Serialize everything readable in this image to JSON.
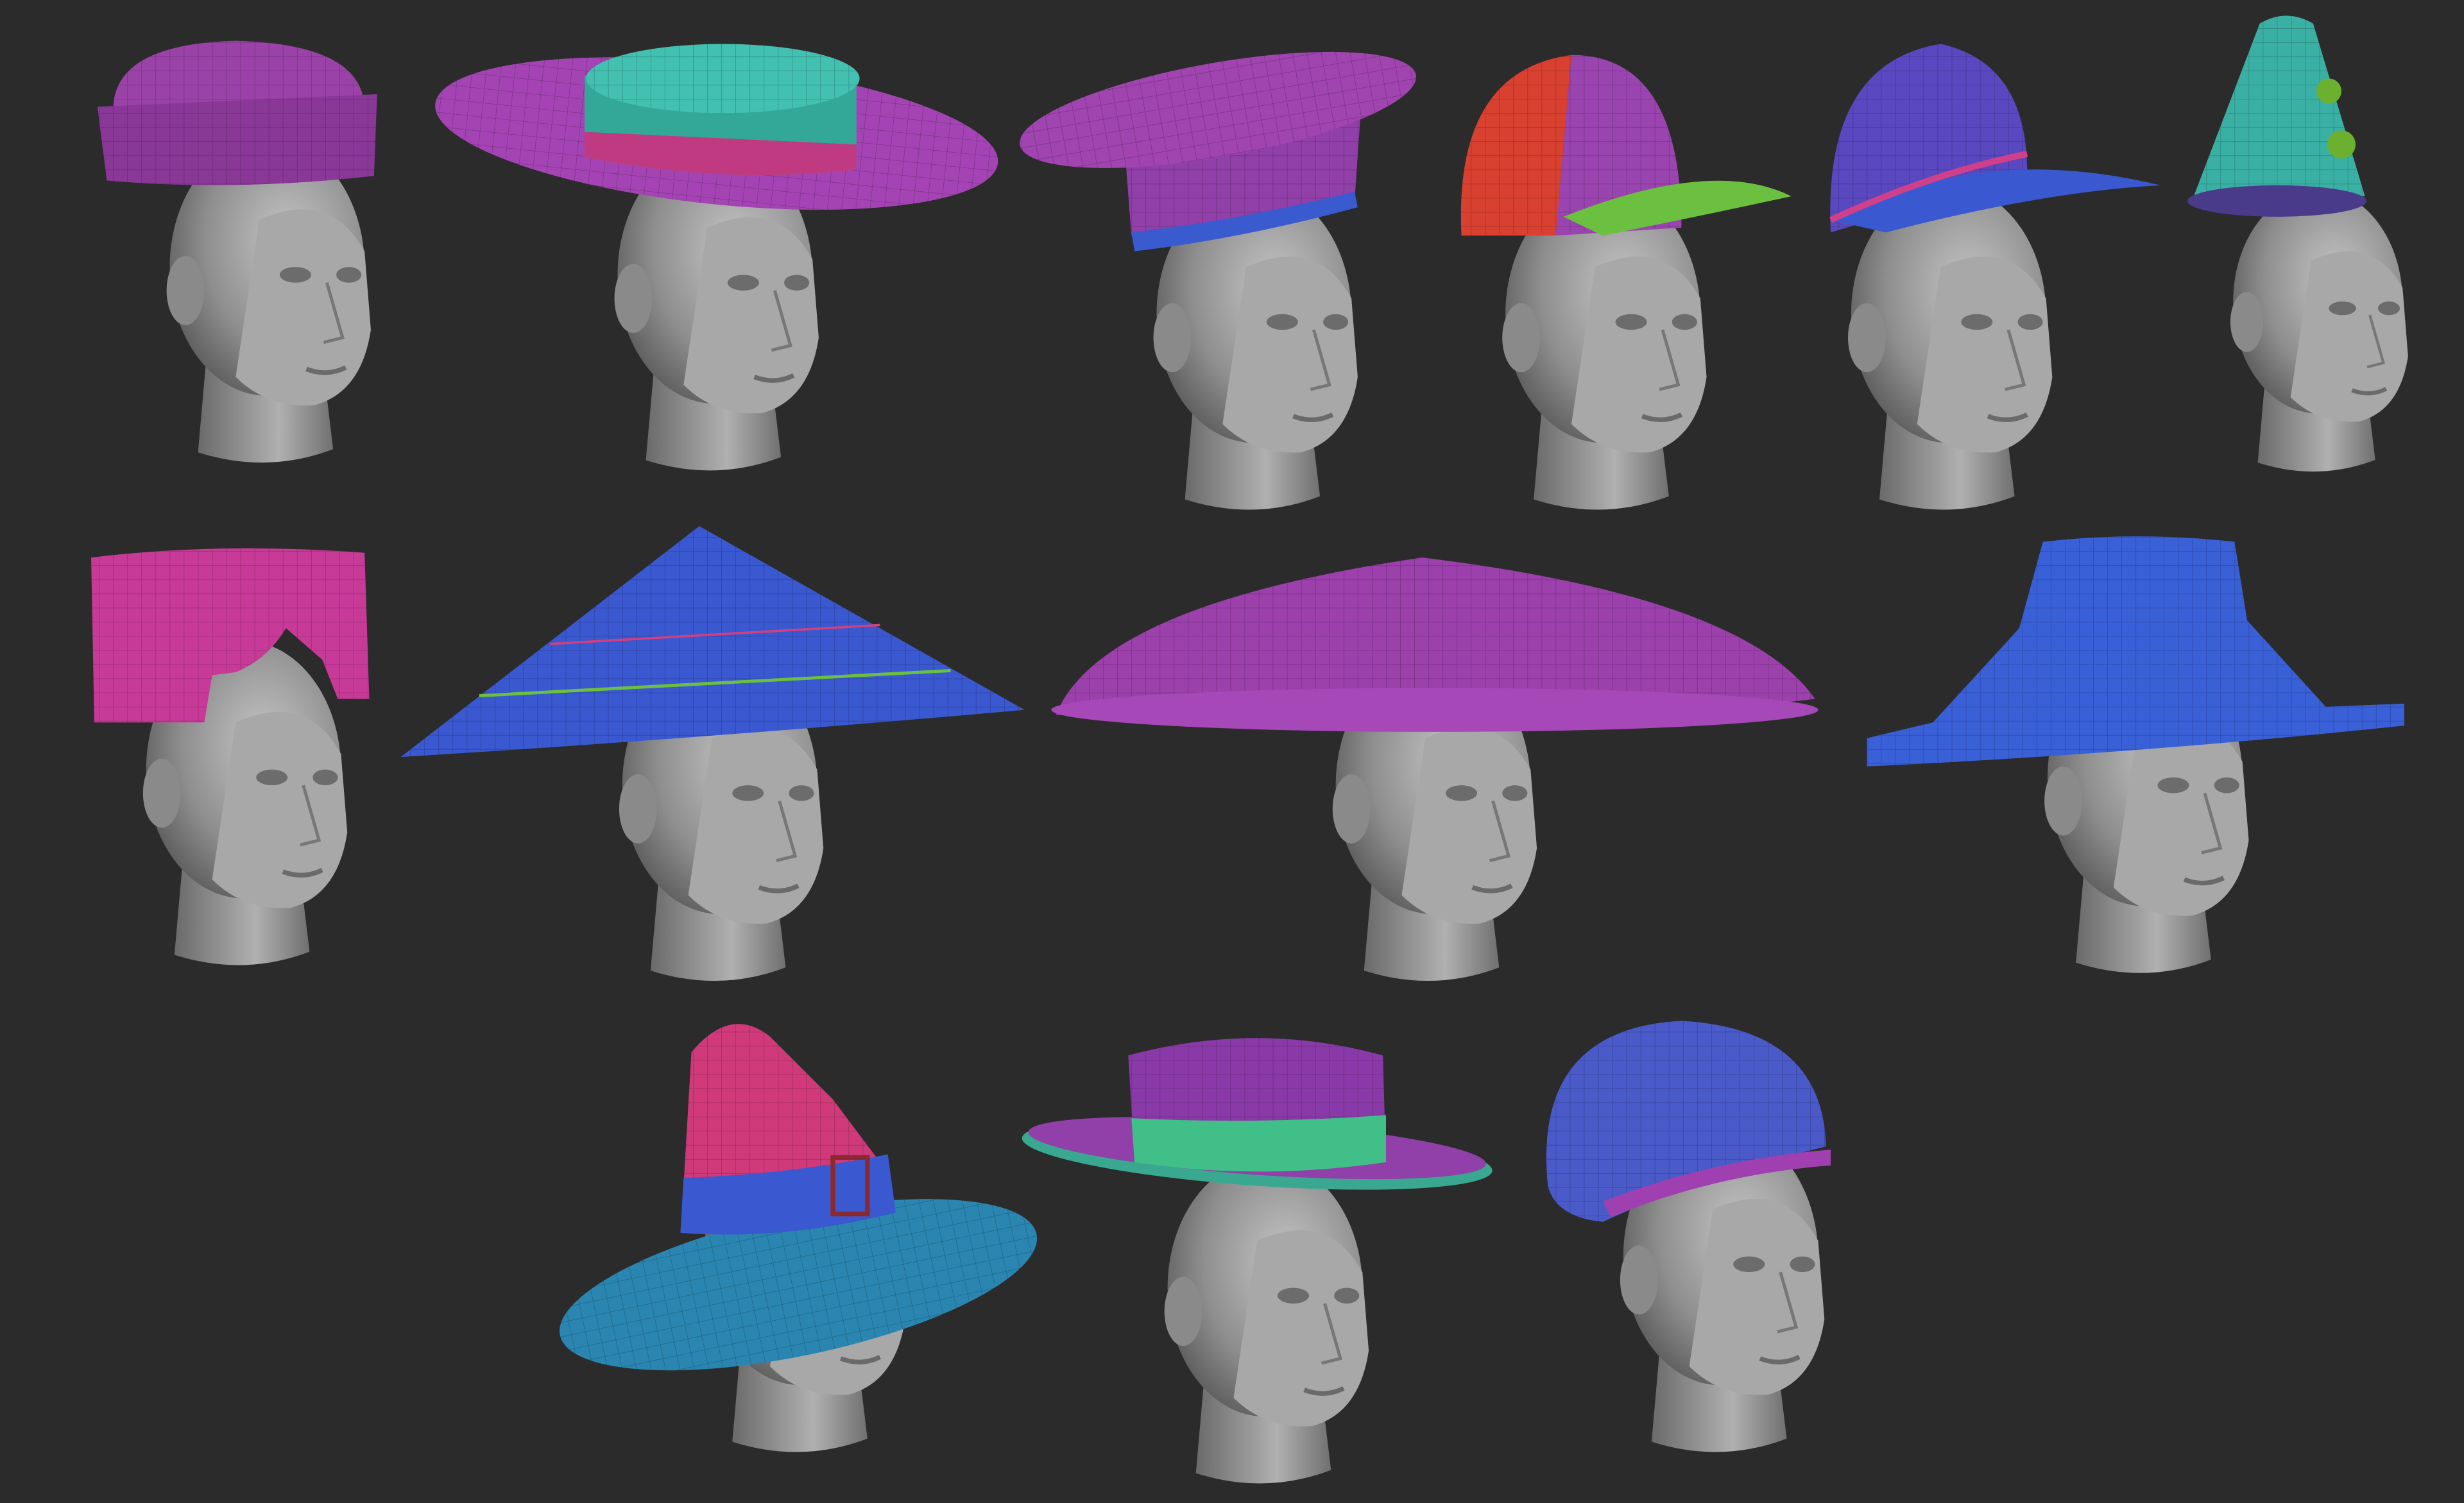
{
  "colors": {
    "background": "#2b2b2b",
    "skin": "#9a9a9a",
    "purple": "#9440a8",
    "magenta": "#c03a9a",
    "pink": "#d0407e",
    "teal": "#38b4a8",
    "blue": "#3a58d0",
    "violet": "#5a44b8",
    "red": "#d84030",
    "green": "#6cc040",
    "sea_green": "#40c088",
    "steel_blue": "#2a86b0"
  }
}
